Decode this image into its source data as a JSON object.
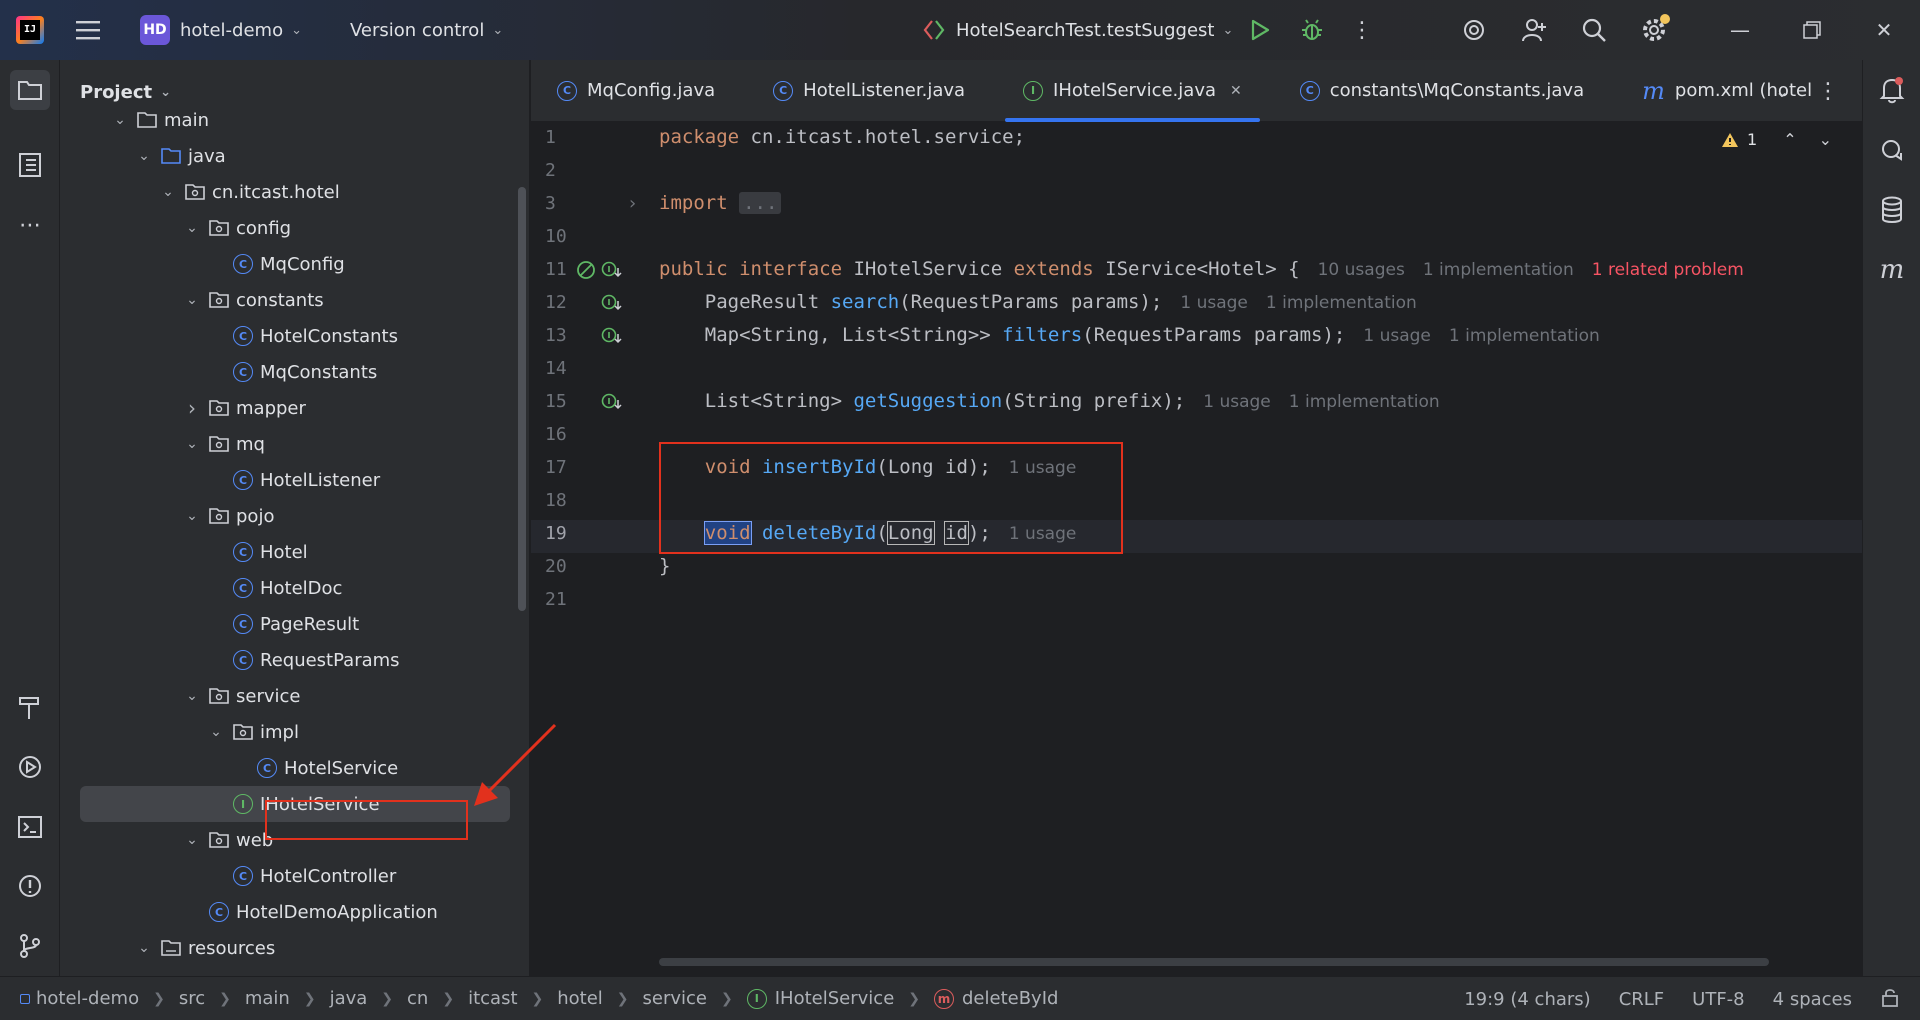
{
  "titlebar": {
    "project_badge": "HD",
    "project_name": "hotel-demo",
    "vcs_label": "Version control",
    "run_config": "HotelSearchTest.testSuggest"
  },
  "left_strip": {
    "icons": [
      "folder-icon",
      "structure-icon",
      "more-icon",
      "build-icon",
      "run-icon",
      "terminal-icon",
      "problems-icon",
      "git-icon"
    ]
  },
  "project_panel": {
    "title": "Project",
    "tree": [
      {
        "label": "main",
        "type": "folder",
        "level": 2,
        "state": "open"
      },
      {
        "label": "java",
        "type": "src-folder",
        "level": 3,
        "state": "open"
      },
      {
        "label": "cn.itcast.hotel",
        "type": "package",
        "level": 4,
        "state": "open"
      },
      {
        "label": "config",
        "type": "package",
        "level": 5,
        "state": "open"
      },
      {
        "label": "MqConfig",
        "type": "class",
        "level": 6,
        "state": "leaf"
      },
      {
        "label": "constants",
        "type": "package",
        "level": 5,
        "state": "open"
      },
      {
        "label": "HotelConstants",
        "type": "class",
        "level": 6,
        "state": "leaf"
      },
      {
        "label": "MqConstants",
        "type": "class",
        "level": 6,
        "state": "leaf"
      },
      {
        "label": "mapper",
        "type": "package",
        "level": 5,
        "state": "closed"
      },
      {
        "label": "mq",
        "type": "package",
        "level": 5,
        "state": "open"
      },
      {
        "label": "HotelListener",
        "type": "class",
        "level": 6,
        "state": "leaf"
      },
      {
        "label": "pojo",
        "type": "package",
        "level": 5,
        "state": "open"
      },
      {
        "label": "Hotel",
        "type": "class",
        "level": 6,
        "state": "leaf"
      },
      {
        "label": "HotelDoc",
        "type": "class",
        "level": 6,
        "state": "leaf"
      },
      {
        "label": "PageResult",
        "type": "class",
        "level": 6,
        "state": "leaf"
      },
      {
        "label": "RequestParams",
        "type": "class",
        "level": 6,
        "state": "leaf"
      },
      {
        "label": "service",
        "type": "package",
        "level": 5,
        "state": "open"
      },
      {
        "label": "impl",
        "type": "package",
        "level": 6,
        "state": "open"
      },
      {
        "label": "HotelService",
        "type": "class",
        "level": 7,
        "state": "leaf"
      },
      {
        "label": "IHotelService",
        "type": "interface",
        "level": 6,
        "state": "leaf",
        "selected": true
      },
      {
        "label": "web",
        "type": "package",
        "level": 5,
        "state": "open"
      },
      {
        "label": "HotelController",
        "type": "class",
        "level": 6,
        "state": "leaf"
      },
      {
        "label": "HotelDemoApplication",
        "type": "app-class",
        "level": 5,
        "state": "leaf"
      },
      {
        "label": "resources",
        "type": "res-folder",
        "level": 3,
        "state": "open"
      }
    ]
  },
  "tabs": [
    {
      "label": "MqConfig.java",
      "icon": "class",
      "active": false
    },
    {
      "label": "HotelListener.java",
      "icon": "class",
      "active": false
    },
    {
      "label": "IHotelService.java",
      "icon": "interface",
      "active": true
    },
    {
      "label": "constants\\MqConstants.java",
      "icon": "class",
      "active": false
    },
    {
      "label": "pom.xml (hotel",
      "icon": "maven",
      "active": false
    }
  ],
  "editor": {
    "warning_count": "1",
    "lines": [
      {
        "n": "1",
        "tokens": [
          [
            "kw",
            "package"
          ],
          [
            "t",
            " cn.itcast.hotel.service;"
          ]
        ]
      },
      {
        "n": "2",
        "tokens": []
      },
      {
        "n": "3",
        "tokens": [
          [
            "kw",
            "import"
          ],
          [
            "t",
            " "
          ],
          [
            "fold",
            "..."
          ]
        ]
      },
      {
        "n": "10",
        "tokens": []
      },
      {
        "n": "11",
        "tokens": [
          [
            "kw",
            "public interface"
          ],
          [
            "t",
            " IHotelService "
          ],
          [
            "kw",
            "extends"
          ],
          [
            "t",
            " IService<Hotel> {"
          ]
        ],
        "hints": [
          [
            "h",
            "10 usages"
          ],
          [
            "h",
            "1 implementation"
          ],
          [
            "err",
            "1 related problem"
          ]
        ]
      },
      {
        "n": "12",
        "tokens": [
          [
            "t",
            "    PageResult "
          ],
          [
            "fn",
            "search"
          ],
          [
            "t",
            "(RequestParams params);"
          ]
        ],
        "hints": [
          [
            "h",
            "1 usage"
          ],
          [
            "h",
            "1 implementation"
          ]
        ]
      },
      {
        "n": "13",
        "tokens": [
          [
            "t",
            "    Map<String, List<String>> "
          ],
          [
            "fn",
            "filters"
          ],
          [
            "t",
            "(RequestParams params);"
          ]
        ],
        "hints": [
          [
            "h",
            "1 usage"
          ],
          [
            "h",
            "1 implementation"
          ]
        ]
      },
      {
        "n": "14",
        "tokens": []
      },
      {
        "n": "15",
        "tokens": [
          [
            "t",
            "    List<String> "
          ],
          [
            "fn",
            "getSuggestion"
          ],
          [
            "t",
            "(String prefix);"
          ]
        ],
        "hints": [
          [
            "h",
            "1 usage"
          ],
          [
            "h",
            "1 implementation"
          ]
        ]
      },
      {
        "n": "16",
        "tokens": []
      },
      {
        "n": "17",
        "tokens": [
          [
            "t",
            "    "
          ],
          [
            "kw",
            "void"
          ],
          [
            "t",
            " "
          ],
          [
            "fn",
            "insertById"
          ],
          [
            "t",
            "(Long id);"
          ]
        ],
        "hints": [
          [
            "h",
            "1 usage"
          ]
        ]
      },
      {
        "n": "18",
        "tokens": []
      },
      {
        "n": "19",
        "tokens": [
          [
            "t",
            "    "
          ],
          [
            "selkw",
            "void"
          ],
          [
            "t",
            " "
          ],
          [
            "fn",
            "deleteById"
          ],
          [
            "t",
            "("
          ],
          [
            "box",
            "Long"
          ],
          [
            "t",
            " "
          ],
          [
            "box",
            "id"
          ],
          [
            "t",
            ");"
          ]
        ],
        "hints": [
          [
            "h",
            "1 usage"
          ]
        ]
      },
      {
        "n": "20",
        "tokens": [
          [
            "t",
            "}"
          ]
        ]
      },
      {
        "n": "21",
        "tokens": []
      }
    ]
  },
  "statusbar": {
    "breadcrumbs": [
      "hotel-demo",
      "src",
      "main",
      "java",
      "cn",
      "itcast",
      "hotel",
      "service",
      "IHotelService",
      "deleteById"
    ],
    "position": "19:9 (4 chars)",
    "line_sep": "CRLF",
    "encoding": "UTF-8",
    "indent": "4 spaces"
  },
  "colors": {
    "accent": "#3574f0",
    "annotation_red": "#e2311d",
    "keyword": "#cf8e6d",
    "function": "#56a8f5"
  }
}
